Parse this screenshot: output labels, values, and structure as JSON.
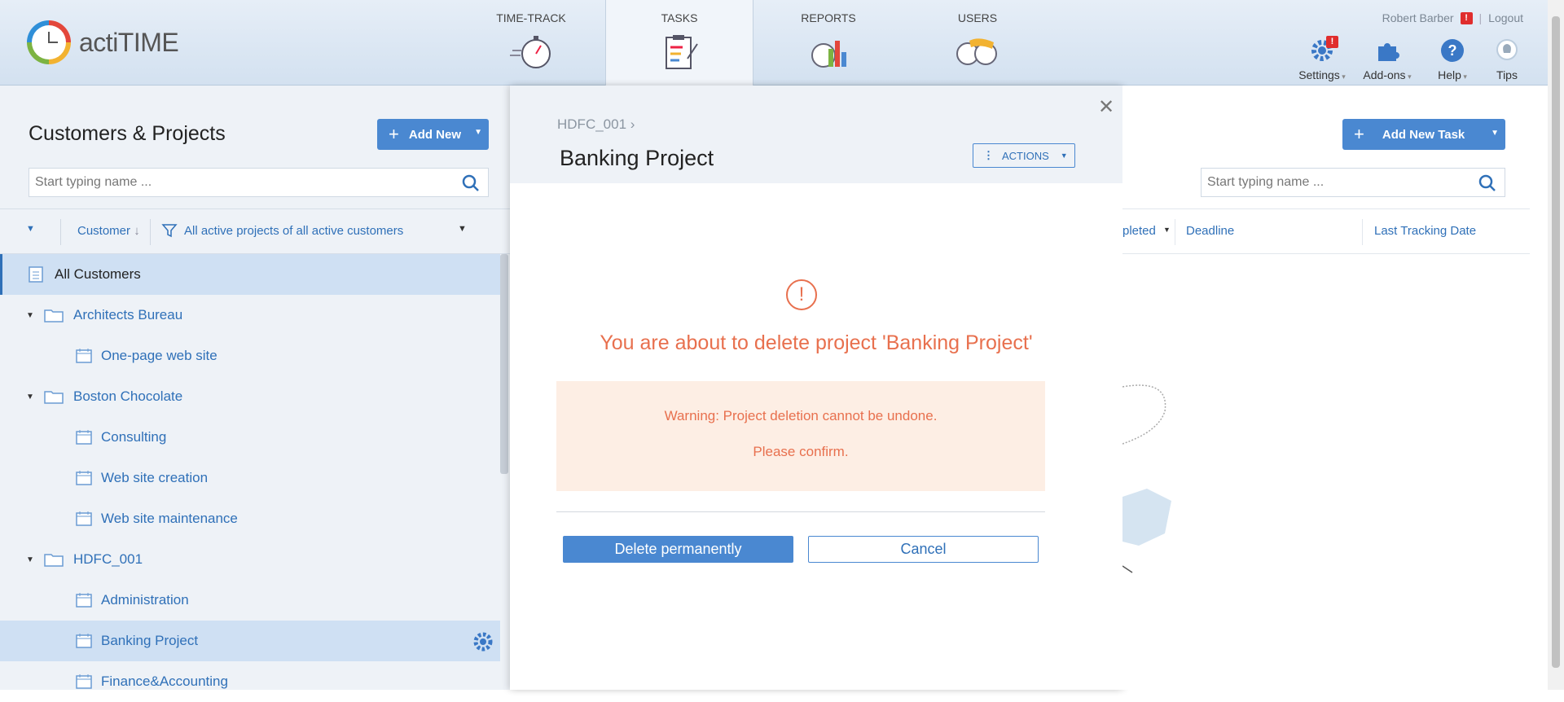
{
  "app": {
    "logo_text": "actiTIME"
  },
  "nav": {
    "tabs": [
      {
        "label": "TIME-TRACK",
        "icon": "stopwatch-icon"
      },
      {
        "label": "TASKS",
        "icon": "clipboard-icon",
        "active": true
      },
      {
        "label": "REPORTS",
        "icon": "chart-icon"
      },
      {
        "label": "USERS",
        "icon": "users-icon"
      }
    ]
  },
  "user": {
    "name": "Robert Barber",
    "logout": "Logout",
    "alert_badge": "!"
  },
  "tools": {
    "settings": "Settings",
    "addons": "Add-ons",
    "help": "Help",
    "tips": "Tips",
    "settings_badge": "!"
  },
  "left": {
    "title": "Customers & Projects",
    "add_new": "Add New",
    "search_placeholder": "Start typing name ...",
    "sort_label": "Customer",
    "filter_label": "All active projects of all active customers",
    "tree": [
      {
        "label": "All Customers",
        "type": "all"
      },
      {
        "label": "Architects Bureau",
        "type": "customer"
      },
      {
        "label": "One-page web site",
        "type": "project"
      },
      {
        "label": "Boston Chocolate",
        "type": "customer"
      },
      {
        "label": "Consulting",
        "type": "project"
      },
      {
        "label": "Web site creation",
        "type": "project"
      },
      {
        "label": "Web site maintenance",
        "type": "project"
      },
      {
        "label": "HDFC_001",
        "type": "customer"
      },
      {
        "label": "Administration",
        "type": "project"
      },
      {
        "label": "Banking Project",
        "type": "project",
        "selected": true
      },
      {
        "label": "Finance&Accounting",
        "type": "project"
      }
    ]
  },
  "modal": {
    "breadcrumb": "HDFC_001",
    "title": "Banking Project",
    "actions_label": "ACTIONS",
    "warning_title": "You are about to delete project 'Banking Project'",
    "warning_line1": "Warning: Project deletion cannot be undone.",
    "warning_line2": "Please confirm.",
    "delete_label": "Delete permanently",
    "cancel_label": "Cancel"
  },
  "right": {
    "add_task": "Add New Task",
    "search_placeholder": "Start typing name ...",
    "columns": [
      "pleted",
      "Deadline",
      "Last Tracking Date"
    ]
  },
  "colors": {
    "accent": "#4a88d1",
    "warning": "#e8704e",
    "link": "#2f70b8"
  }
}
